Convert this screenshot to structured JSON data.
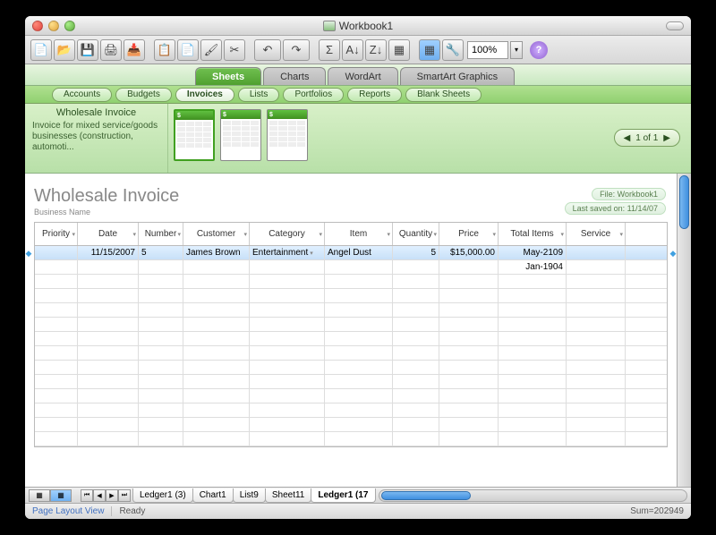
{
  "window": {
    "title": "Workbook1"
  },
  "toolbar": {
    "zoom": "100%"
  },
  "ribbon_tabs": [
    "Sheets",
    "Charts",
    "WordArt",
    "SmartArt Graphics"
  ],
  "ribbon_active": 0,
  "sub_tabs": [
    "Accounts",
    "Budgets",
    "Invoices",
    "Lists",
    "Portfolios",
    "Reports",
    "Blank Sheets"
  ],
  "sub_active": 2,
  "gallery": {
    "title": "Wholesale Invoice",
    "desc": "Invoice for mixed service/goods businesses (construction, automoti...",
    "pager": "1 of 1"
  },
  "document": {
    "title": "Wholesale Invoice",
    "subtitle": "Business Name",
    "file_label": "File: Workbook1",
    "saved_label": "Last saved on: 11/14/07"
  },
  "columns": [
    "Priority",
    "Date",
    "Number",
    "Customer",
    "Category",
    "Item",
    "Quantity",
    "Price",
    "Total Items",
    "Service"
  ],
  "rows": [
    {
      "priority": "",
      "date": "11/15/2007",
      "number": "5",
      "customer": "James Brown",
      "category": "Entertainment",
      "item": "Angel Dust",
      "quantity": "5",
      "price": "$15,000.00",
      "total": "May-2109",
      "service": ""
    },
    {
      "priority": "",
      "date": "",
      "number": "",
      "customer": "",
      "category": "",
      "item": "",
      "quantity": "",
      "price": "",
      "total": "Jan-1904",
      "service": ""
    }
  ],
  "sheet_tabs": [
    "Ledger1 (3)",
    "Chart1",
    "List9",
    "Sheet11",
    "Ledger1 (17"
  ],
  "sheet_active": 4,
  "status": {
    "left": "Page Layout View",
    "mid": "Ready",
    "right": "Sum=202949"
  }
}
